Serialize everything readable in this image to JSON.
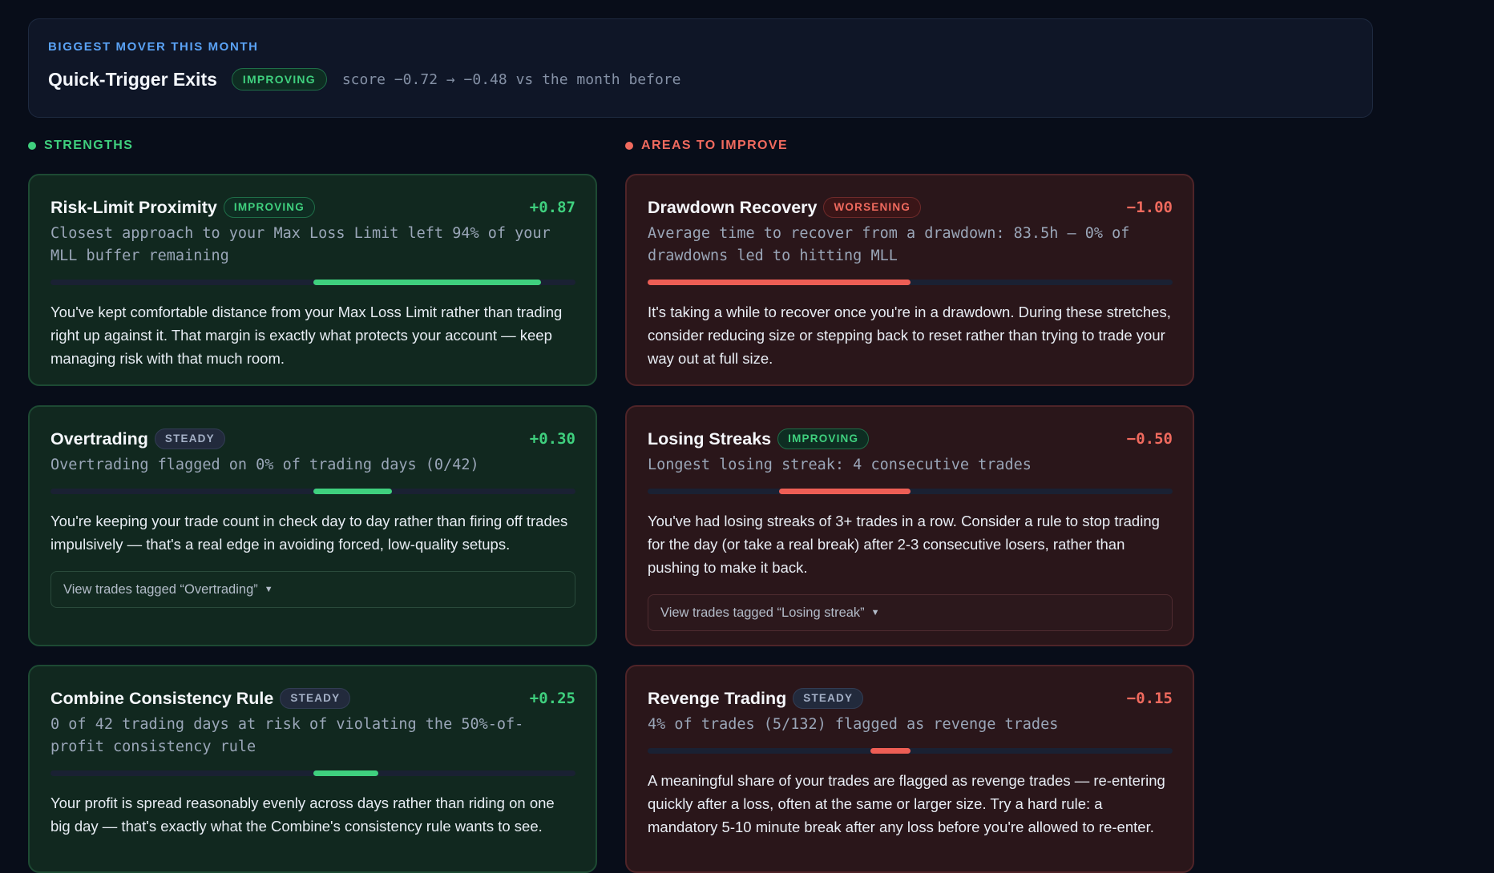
{
  "mover": {
    "eyebrow": "BIGGEST MOVER THIS MONTH",
    "title": "Quick-Trigger Exits",
    "badge": "IMPROVING",
    "score_text": "score −0.72 → −0.48 vs the month before"
  },
  "sections": {
    "strengths": "STRENGTHS",
    "improve": "AREAS TO IMPROVE"
  },
  "strengths": [
    {
      "title": "Risk-Limit Proximity",
      "badge": "IMPROVING",
      "score": "+0.87",
      "score_value": 0.87,
      "metric": "Closest approach to your Max Loss Limit left 94% of your MLL buffer remaining",
      "body": "You've kept comfortable distance from your Max Loss Limit rather than trading right up against it. That margin is exactly what protects your account — keep managing risk with that much room."
    },
    {
      "title": "Overtrading",
      "badge": "STEADY",
      "score": "+0.30",
      "score_value": 0.3,
      "metric": "Overtrading flagged on 0% of trading days (0/42)",
      "body": "You're keeping your trade count in check day to day rather than firing off trades impulsively — that's a real edge in avoiding forced, low-quality setups.",
      "link": "View trades tagged “Overtrading”"
    },
    {
      "title": "Combine Consistency Rule",
      "badge": "STEADY",
      "score": "+0.25",
      "score_value": 0.25,
      "metric": "0 of 42 trading days at risk of violating the 50%-of-profit consistency rule",
      "body": "Your profit is spread reasonably evenly across days rather than riding on one big day — that's exactly what the Combine's consistency rule wants to see."
    }
  ],
  "improve": [
    {
      "title": "Drawdown Recovery",
      "badge": "WORSENING",
      "score": "−1.00",
      "score_value": -1.0,
      "metric": "Average time to recover from a drawdown: 83.5h — 0% of drawdowns led to hitting MLL",
      "body": "It's taking a while to recover once you're in a drawdown. During these stretches, consider reducing size or stepping back to reset rather than trying to trade your way out at full size."
    },
    {
      "title": "Losing Streaks",
      "badge": "IMPROVING",
      "score": "−0.50",
      "score_value": -0.5,
      "metric": "Longest losing streak: 4 consecutive trades",
      "body": "You've had losing streaks of 3+ trades in a row. Consider a rule to stop trading for the day (or take a real break) after 2-3 consecutive losers, rather than pushing to make it back.",
      "link": "View trades tagged “Losing streak”"
    },
    {
      "title": "Revenge Trading",
      "badge": "STEADY",
      "score": "−0.15",
      "score_value": -0.15,
      "metric": "4% of trades (5/132) flagged as revenge trades",
      "body": "A meaningful share of your trades are flagged as revenge trades — re-entering quickly after a loss, often at the same or larger size. Try a hard rule: a mandatory 5-10 minute break after any loss before you're allowed to re-enter."
    }
  ]
}
